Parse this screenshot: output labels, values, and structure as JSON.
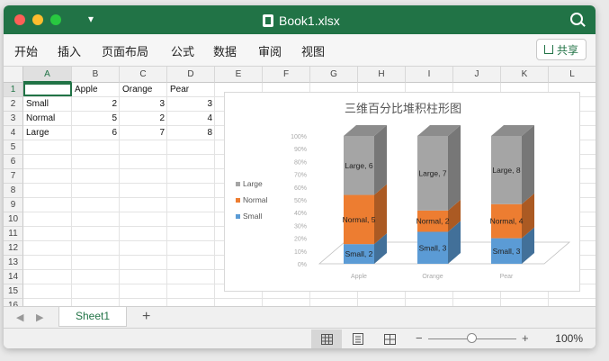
{
  "window": {
    "title": "Book1.xlsx"
  },
  "menu": [
    "开始",
    "插入",
    "页面布局",
    "公式",
    "数据",
    "审阅",
    "视图"
  ],
  "share_label": "共享",
  "columns": [
    "A",
    "B",
    "C",
    "D",
    "E",
    "F",
    "G",
    "H",
    "I",
    "J",
    "K",
    "L"
  ],
  "rows": [
    "1",
    "2",
    "3",
    "4",
    "5",
    "6",
    "7",
    "8",
    "9",
    "10",
    "11",
    "12",
    "13",
    "14",
    "15",
    "16"
  ],
  "cells": {
    "header": [
      "",
      "Apple",
      "Orange",
      "Pear"
    ],
    "data": [
      [
        "Small",
        "2",
        "3",
        "3"
      ],
      [
        "Normal",
        "5",
        "2",
        "4"
      ],
      [
        "Large",
        "6",
        "7",
        "8"
      ]
    ]
  },
  "chart_data": {
    "type": "bar",
    "stacked": "percent",
    "title": "三维百分比堆积柱形图",
    "categories": [
      "Apple",
      "Orange",
      "Pear"
    ],
    "series": [
      {
        "name": "Small",
        "values": [
          2,
          3,
          3
        ],
        "color": "#5b9bd5"
      },
      {
        "name": "Normal",
        "values": [
          5,
          2,
          4
        ],
        "color": "#ed7d31"
      },
      {
        "name": "Large",
        "values": [
          6,
          7,
          8
        ],
        "color": "#a5a5a5"
      }
    ],
    "ylim": [
      0,
      100
    ],
    "yticks": [
      "0%",
      "10%",
      "20%",
      "30%",
      "40%",
      "50%",
      "60%",
      "70%",
      "80%",
      "90%",
      "100%"
    ],
    "legend_position": "left",
    "data_labels": [
      [
        "Small, 2",
        "Small, 3",
        "Small, 3"
      ],
      [
        "Normal, 5",
        "Normal, 2",
        "Normal, 4"
      ],
      [
        "Large, 6",
        "Large, 7",
        "Large, 8"
      ]
    ]
  },
  "tabs": {
    "sheet": "Sheet1"
  },
  "status": {
    "zoom": "100%"
  },
  "colors": {
    "excel_green": "#217346"
  }
}
